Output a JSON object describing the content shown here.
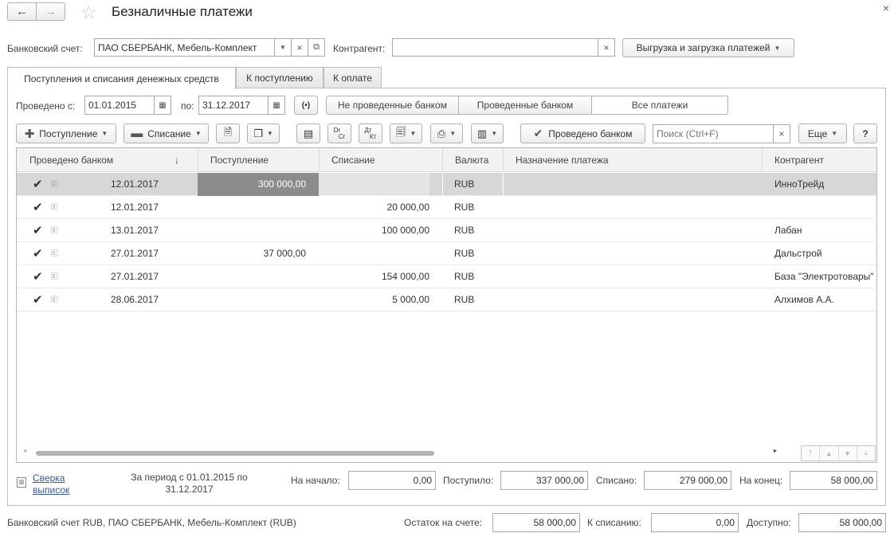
{
  "window": {
    "title": "Безналичные платежи"
  },
  "filters": {
    "bank_account_label": "Банковский счет:",
    "bank_account_value": "ПАО СБЕРБАНК, Мебель-Комплект",
    "counterparty_label": "Контрагент:",
    "counterparty_value": "",
    "export_button": "Выгрузка и загрузка платежей"
  },
  "tabs": [
    "Поступления и списания денежных средств",
    "К поступлению",
    "К оплате"
  ],
  "period": {
    "from_label": "Проведено с:",
    "from_value": "01.01.2015",
    "to_label": "по:",
    "to_value": "31.12.2017"
  },
  "segments": [
    "Не проведенные банком",
    "Проведенные банком",
    "Все платежи"
  ],
  "toolbar": {
    "receipt_button": "Поступление",
    "writeoff_button": "Списание",
    "dr_top": "Dr",
    "dr_bottom": "Cr",
    "dt_top": "Дт",
    "dt_bottom": "Кт",
    "bank_done_button": "Проведено банком",
    "search_placeholder": "Поиск (Ctrl+F)",
    "more_button": "Еще",
    "help_button": "?"
  },
  "table": {
    "headers": [
      "Проведено банком",
      "Поступление",
      "Списание",
      "Валюта",
      "Назначение платежа",
      "Контрагент"
    ],
    "sort_arrow": "↓",
    "rows": [
      {
        "date": "12.01.2017",
        "receipt": "300 000,00",
        "writeoff": "",
        "currency": "RUB",
        "purpose": "",
        "counterparty": "ИнноТрейд",
        "selected": true
      },
      {
        "date": "12.01.2017",
        "receipt": "",
        "writeoff": "20 000,00",
        "currency": "RUB",
        "purpose": "",
        "counterparty": "",
        "selected": false
      },
      {
        "date": "13.01.2017",
        "receipt": "",
        "writeoff": "100 000,00",
        "currency": "RUB",
        "purpose": "",
        "counterparty": "Лабан",
        "selected": false
      },
      {
        "date": "27.01.2017",
        "receipt": "37 000,00",
        "writeoff": "",
        "currency": "RUB",
        "purpose": "",
        "counterparty": "Дальстрой",
        "selected": false
      },
      {
        "date": "27.01.2017",
        "receipt": "",
        "writeoff": "154 000,00",
        "currency": "RUB",
        "purpose": "",
        "counterparty": "База \"Электротовары\"",
        "selected": false
      },
      {
        "date": "28.06.2017",
        "receipt": "",
        "writeoff": "5 000,00",
        "currency": "RUB",
        "purpose": "",
        "counterparty": "Алхимов А.А.",
        "selected": false
      }
    ]
  },
  "summary": {
    "reconcile_link_line1": "Сверка",
    "reconcile_link_line2": "выписок",
    "period_text_line1": "За период с 01.01.2015 по",
    "period_text_line2": "31.12.2017",
    "start_label": "На начало:",
    "start_value": "0,00",
    "received_label": "Поступило:",
    "received_value": "337 000,00",
    "writtenoff_label": "Списано:",
    "writtenoff_value": "279 000,00",
    "end_label": "На конец:",
    "end_value": "58 000,00"
  },
  "footer": {
    "account_text": "Банковский счет RUB, ПАО СБЕРБАНК, Мебель-Комплект (RUB)",
    "balance_label": "Остаток на счете:",
    "balance_value": "58 000,00",
    "to_writeoff_label": "К списанию:",
    "to_writeoff_value": "0,00",
    "available_label": "Доступно:",
    "available_value": "58 000,00"
  },
  "scroll_position": 0.5
}
